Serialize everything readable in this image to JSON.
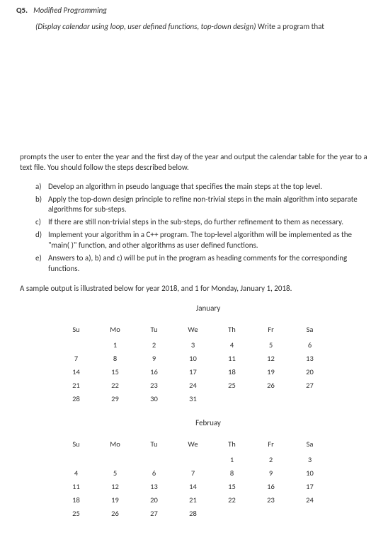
{
  "question": {
    "number": "Q5.",
    "title": "Modified Programming"
  },
  "intro_italic": "(Display calendar using loop, user defined functions, top-down design)",
  "intro_plain": " Write a program that",
  "continuation": "prompts the user to enter the year and the first day of the year and output the calendar table for the year to a text file. You should follow the steps described below.",
  "items": {
    "a": "Develop an algorithm in pseudo language that specifies the main steps at the top level.",
    "b": "Apply the top-down design principle to refine non-trivial steps in the main algorithm into separate algorithms for sub-steps.",
    "c": "If there are still non-trivial steps in the sub-steps, do further refinement to them as necessary.",
    "d": "Implement your algorithm in a C++ program. The top-level algorithm will be implemented as the \"main( )\" function, and other algorithms as user defined functions.",
    "e": "Answers to a), b) and c) will be put in the program as heading comments for the corresponding functions."
  },
  "markers": {
    "a": "a)",
    "b": "b)",
    "c": "c)",
    "d": "d)",
    "e": "e)"
  },
  "sample_line": "A sample output is illustrated below for year 2018, and 1 for Monday, January 1, 2018.",
  "day_headers": {
    "su": "Su",
    "mo": "Mo",
    "tu": "Tu",
    "we": "We",
    "th": "Th",
    "fr": "Fr",
    "sa": "Sa"
  },
  "months": {
    "jan": {
      "title": "January",
      "rows": [
        [
          "",
          "1",
          "2",
          "3",
          "4",
          "5",
          "6"
        ],
        [
          "7",
          "8",
          "9",
          "10",
          "11",
          "12",
          "13"
        ],
        [
          "14",
          "15",
          "16",
          "17",
          "18",
          "19",
          "20"
        ],
        [
          "21",
          "22",
          "23",
          "24",
          "25",
          "26",
          "27"
        ],
        [
          "28",
          "29",
          "30",
          "31",
          "",
          "",
          ""
        ]
      ]
    },
    "feb": {
      "title": "Februay",
      "rows": [
        [
          "",
          "",
          "",
          "",
          "1",
          "2",
          "3"
        ],
        [
          "4",
          "5",
          "6",
          "7",
          "8",
          "9",
          "10"
        ],
        [
          "11",
          "12",
          "13",
          "14",
          "15",
          "16",
          "17"
        ],
        [
          "18",
          "19",
          "20",
          "21",
          "22",
          "23",
          "24"
        ],
        [
          "25",
          "26",
          "27",
          "28",
          "",
          "",
          ""
        ]
      ]
    }
  }
}
